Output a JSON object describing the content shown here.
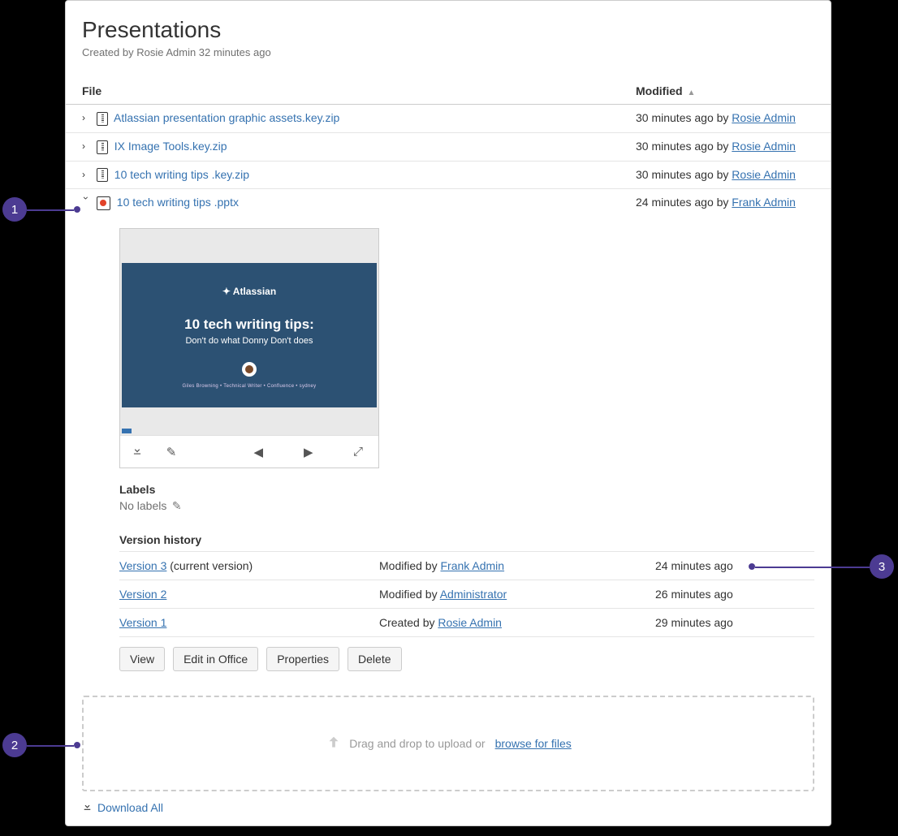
{
  "header": {
    "title": "Presentations",
    "byline_prefix": "Created by ",
    "byline_author": "Rosie Admin",
    "byline_time": " 32 minutes ago"
  },
  "table": {
    "col_file": "File",
    "col_modified": "Modified"
  },
  "files": [
    {
      "name": "Atlassian presentation graphic assets.key.zip",
      "type": "zip",
      "modified_time": "30 minutes ago by ",
      "modified_by": "Rosie Admin",
      "expanded": false
    },
    {
      "name": "IX Image Tools.key.zip",
      "type": "zip",
      "modified_time": "30 minutes ago by ",
      "modified_by": "Rosie Admin",
      "expanded": false
    },
    {
      "name": "10 tech writing tips .key.zip",
      "type": "zip",
      "modified_time": "30 minutes ago by ",
      "modified_by": "Rosie Admin",
      "expanded": false
    },
    {
      "name": "10 tech writing tips .pptx",
      "type": "pptx",
      "modified_time": "24 minutes ago by ",
      "modified_by": "Frank Admin",
      "expanded": true
    }
  ],
  "preview": {
    "logo": "Atlassian",
    "title": "10 tech writing tips:",
    "subtitle": "Don't do what Donny Don't does",
    "footer": "Giles Browning  •  Technical Writer  •  Confluence  •  sydney"
  },
  "labels": {
    "heading": "Labels",
    "none": "No labels"
  },
  "version_history": {
    "heading": "Version history",
    "rows": [
      {
        "version": "Version 3",
        "suffix": " (current version)",
        "action": "Modified by ",
        "who": "Frank Admin",
        "when": "24 minutes ago"
      },
      {
        "version": "Version 2",
        "suffix": "",
        "action": "Modified by ",
        "who": "Administrator",
        "when": "26 minutes ago"
      },
      {
        "version": "Version 1",
        "suffix": "",
        "action": "Created by ",
        "who": "Rosie Admin",
        "when": "29 minutes ago"
      }
    ],
    "buttons": {
      "view": "View",
      "edit": "Edit in Office",
      "properties": "Properties",
      "delete": "Delete"
    }
  },
  "dropzone": {
    "text": "Drag and drop to upload or ",
    "browse": "browse for files"
  },
  "download_all": "Download All",
  "callouts": {
    "c1": "1",
    "c2": "2",
    "c3": "3"
  }
}
